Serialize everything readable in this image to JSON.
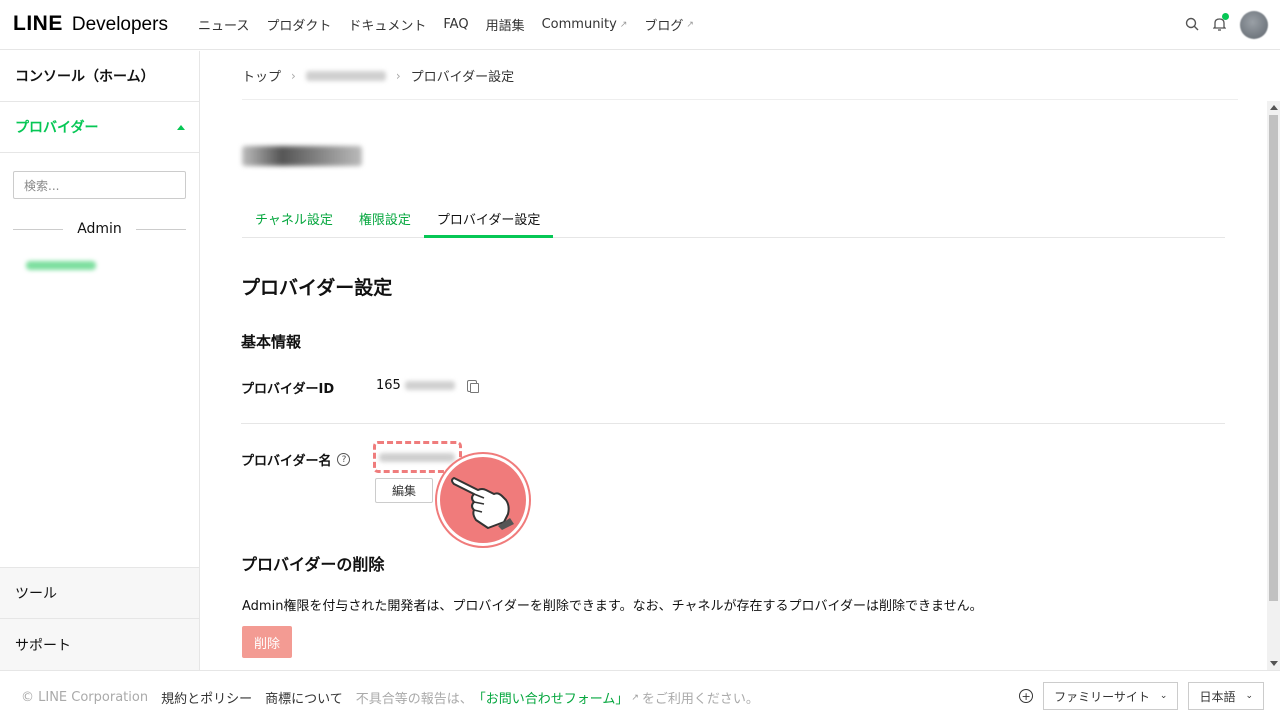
{
  "header": {
    "logo_line": "LINE",
    "logo_dev": "Developers",
    "nav": [
      {
        "label": "ニュース",
        "external": false
      },
      {
        "label": "プロダクト",
        "external": false
      },
      {
        "label": "ドキュメント",
        "external": false
      },
      {
        "label": "FAQ",
        "external": false
      },
      {
        "label": "用語集",
        "external": false
      },
      {
        "label": "Community",
        "external": true
      },
      {
        "label": "ブログ",
        "external": true
      }
    ],
    "icons": [
      "search-icon",
      "bell-icon",
      "avatar"
    ]
  },
  "sidebar": {
    "console_home": "コンソール（ホーム）",
    "provider": "プロバイダー",
    "search_placeholder": "検索...",
    "section_label": "Admin",
    "tools": "ツール",
    "support": "サポート"
  },
  "main": {
    "breadcrumb": {
      "top": "トップ",
      "current": "プロバイダー設定"
    },
    "tabs": [
      "チャネル設定",
      "権限設定",
      "プロバイダー設定"
    ],
    "active_tab": "プロバイダー設定",
    "page_title": "プロバイダー設定",
    "basic_info": "基本情報",
    "provider_id_label": "プロバイダーID",
    "provider_id_prefix": "165",
    "provider_name_label": "プロバイダー名",
    "edit_button": "編集",
    "delete_section_title": "プロバイダーの削除",
    "delete_description": "Admin権限を付与された開発者は、プロバイダーを削除できます。なお、チャネルが存在するプロバイダーは削除できません。",
    "delete_button": "削除"
  },
  "footer": {
    "copyright": "© LINE Corporation",
    "terms": "規約とポリシー",
    "trademark": "商標について",
    "report_prefix": "不具合等の報告は、",
    "report_link": "「お問い合わせフォーム」",
    "report_suffix": "をご利用ください。",
    "family_site": "ファミリーサイト",
    "language": "日本語"
  },
  "colors": {
    "accent": "#06c755",
    "highlight": "#ef7c7c",
    "delete": "#f39b93"
  }
}
